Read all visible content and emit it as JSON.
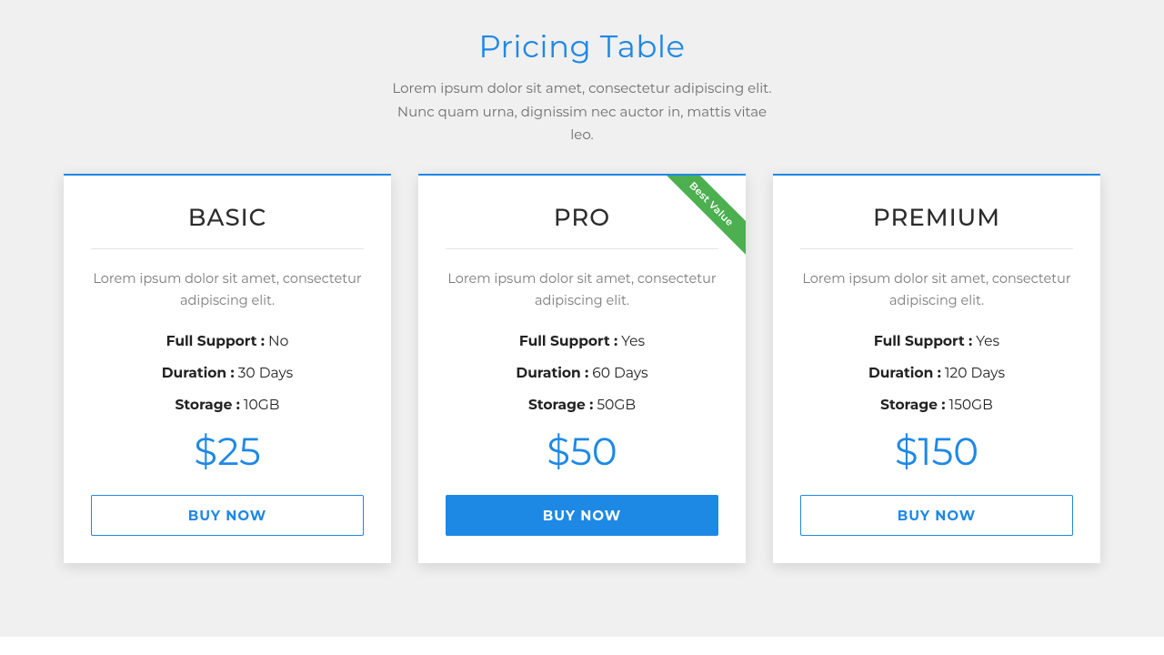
{
  "header": {
    "title": "Pricing Table",
    "subtitle": "Lorem ipsum dolor sit amet, consectetur adipiscing elit. Nunc quam urna, dignissim nec auctor in, mattis vitae leo."
  },
  "labels": {
    "full_support": "Full Support",
    "duration": "Duration",
    "storage": "Storage",
    "buy_now": "BUY NOW"
  },
  "plans": [
    {
      "id": "basic",
      "name": "BASIC",
      "desc": "Lorem ipsum dolor sit amet, consectetur adipiscing elit.",
      "full_support": "No",
      "duration": "30 Days",
      "storage": "10GB",
      "price": "$25",
      "ribbon": null,
      "primary": false
    },
    {
      "id": "pro",
      "name": "PRO",
      "desc": "Lorem ipsum dolor sit amet, consectetur adipiscing elit.",
      "full_support": "Yes",
      "duration": "60 Days",
      "storage": "50GB",
      "price": "$50",
      "ribbon": "Best Value",
      "primary": true
    },
    {
      "id": "premium",
      "name": "PREMIUM",
      "desc": "Lorem ipsum dolor sit amet, consectetur adipiscing elit.",
      "full_support": "Yes",
      "duration": "120 Days",
      "storage": "150GB",
      "price": "$150",
      "ribbon": null,
      "primary": false
    }
  ]
}
